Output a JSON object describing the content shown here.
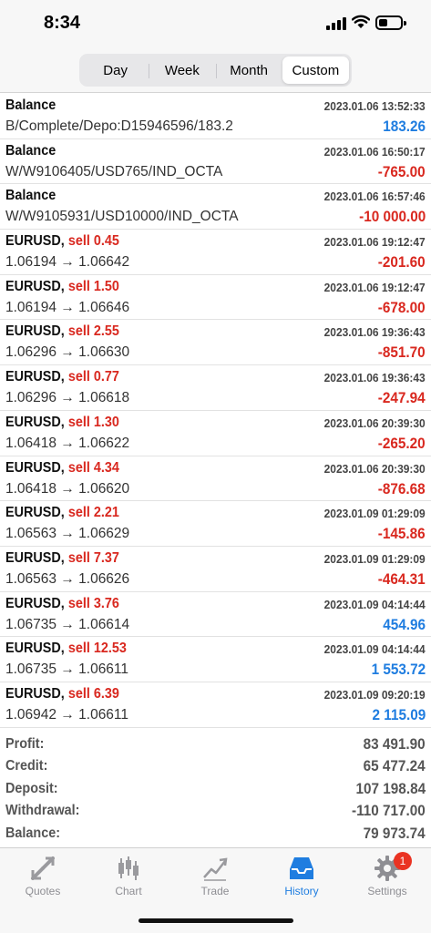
{
  "status_bar": {
    "time": "8:34"
  },
  "segments": [
    {
      "label": "Day",
      "active": false
    },
    {
      "label": "Week",
      "active": false
    },
    {
      "label": "Month",
      "active": false
    },
    {
      "label": "Custom",
      "active": true
    }
  ],
  "deals": [
    {
      "title": "Balance",
      "symbol": "",
      "side": "",
      "sub": "B/Complete/Depo:D15946596/183.2",
      "date": "2023.01.06 13:52:33",
      "amount": "183.26",
      "positive": true
    },
    {
      "title": "Balance",
      "symbol": "",
      "side": "",
      "sub": "W/W9106405/USD765/IND_OCTA",
      "date": "2023.01.06 16:50:17",
      "amount": "-765.00",
      "positive": false
    },
    {
      "title": "Balance",
      "symbol": "",
      "side": "",
      "sub": "W/W9105931/USD10000/IND_OCTA",
      "date": "2023.01.06 16:57:46",
      "amount": "-10 000.00",
      "positive": false
    },
    {
      "title": "",
      "symbol": "EURUSD,",
      "side": "sell 0.45",
      "sub": "1.06194 → 1.06642",
      "date": "2023.01.06 19:12:47",
      "amount": "-201.60",
      "positive": false
    },
    {
      "title": "",
      "symbol": "EURUSD,",
      "side": "sell 1.50",
      "sub": "1.06194 → 1.06646",
      "date": "2023.01.06 19:12:47",
      "amount": "-678.00",
      "positive": false
    },
    {
      "title": "",
      "symbol": "EURUSD,",
      "side": "sell 2.55",
      "sub": "1.06296 → 1.06630",
      "date": "2023.01.06 19:36:43",
      "amount": "-851.70",
      "positive": false
    },
    {
      "title": "",
      "symbol": "EURUSD,",
      "side": "sell 0.77",
      "sub": "1.06296 → 1.06618",
      "date": "2023.01.06 19:36:43",
      "amount": "-247.94",
      "positive": false
    },
    {
      "title": "",
      "symbol": "EURUSD,",
      "side": "sell 1.30",
      "sub": "1.06418 → 1.06622",
      "date": "2023.01.06 20:39:30",
      "amount": "-265.20",
      "positive": false
    },
    {
      "title": "",
      "symbol": "EURUSD,",
      "side": "sell 4.34",
      "sub": "1.06418 → 1.06620",
      "date": "2023.01.06 20:39:30",
      "amount": "-876.68",
      "positive": false
    },
    {
      "title": "",
      "symbol": "EURUSD,",
      "side": "sell 2.21",
      "sub": "1.06563 → 1.06629",
      "date": "2023.01.09 01:29:09",
      "amount": "-145.86",
      "positive": false
    },
    {
      "title": "",
      "symbol": "EURUSD,",
      "side": "sell 7.37",
      "sub": "1.06563 → 1.06626",
      "date": "2023.01.09 01:29:09",
      "amount": "-464.31",
      "positive": false
    },
    {
      "title": "",
      "symbol": "EURUSD,",
      "side": "sell 3.76",
      "sub": "1.06735 → 1.06614",
      "date": "2023.01.09 04:14:44",
      "amount": "454.96",
      "positive": true
    },
    {
      "title": "",
      "symbol": "EURUSD,",
      "side": "sell 12.53",
      "sub": "1.06735 → 1.06611",
      "date": "2023.01.09 04:14:44",
      "amount": "1 553.72",
      "positive": true
    },
    {
      "title": "",
      "symbol": "EURUSD,",
      "side": "sell 6.39",
      "sub": "1.06942 → 1.06611",
      "date": "2023.01.09 09:20:19",
      "amount": "2 115.09",
      "positive": true
    }
  ],
  "summary": [
    {
      "label": "Profit:",
      "value": "83 491.90"
    },
    {
      "label": "Credit:",
      "value": "65 477.24"
    },
    {
      "label": "Deposit:",
      "value": "107 198.84"
    },
    {
      "label": "Withdrawal:",
      "value": "-110 717.00"
    },
    {
      "label": "Balance:",
      "value": "79 973.74"
    }
  ],
  "tabs": [
    {
      "label": "Quotes",
      "icon": "quotes-icon",
      "active": false
    },
    {
      "label": "Chart",
      "icon": "chart-icon",
      "active": false
    },
    {
      "label": "Trade",
      "icon": "trade-icon",
      "active": false
    },
    {
      "label": "History",
      "icon": "history-icon",
      "active": true
    },
    {
      "label": "Settings",
      "icon": "gear-icon",
      "active": false,
      "badge": "1"
    }
  ],
  "colors": {
    "negative": "#d9281f",
    "positive": "#1f7de0",
    "accent": "#1f7de0",
    "badge": "#ea3323"
  }
}
